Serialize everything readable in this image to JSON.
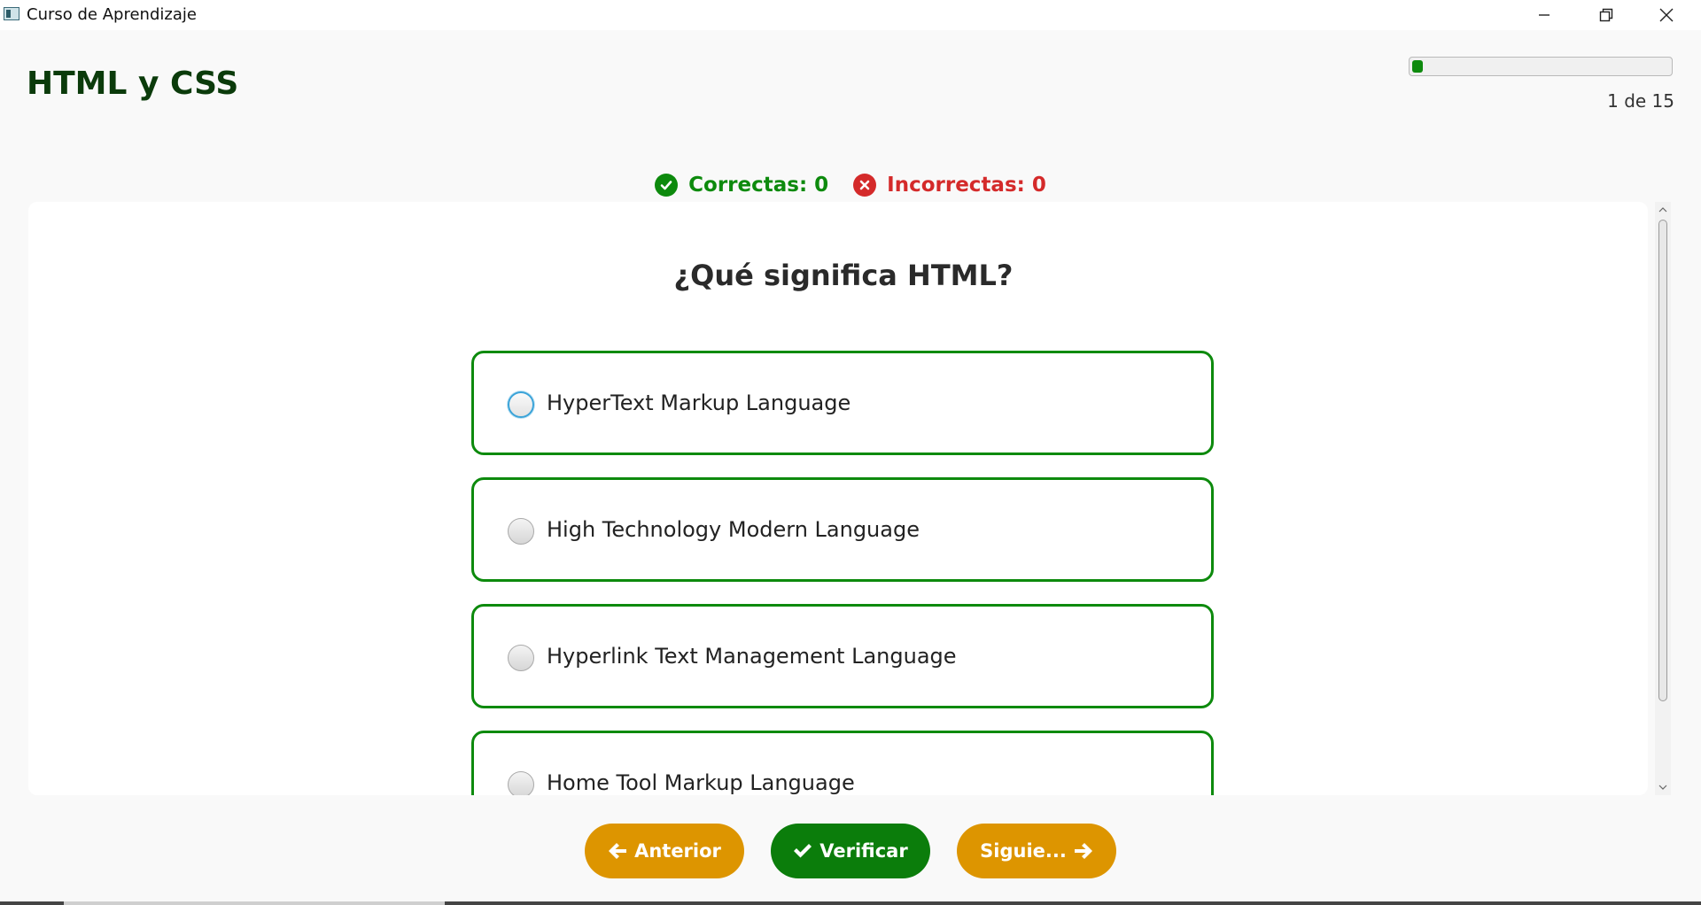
{
  "window": {
    "title": "Curso de Aprendizaje",
    "icons": {
      "minimize": "minimize-icon",
      "maximize": "restore-icon",
      "close": "close-icon"
    }
  },
  "header": {
    "course_title": "HTML y CSS",
    "progress": {
      "current": 1,
      "total": 15,
      "fraction": 0.0667,
      "text": "1 de 15"
    }
  },
  "scores": {
    "correct_label": "Correctas: 0",
    "incorrect_label": "Incorrectas: 0",
    "colors": {
      "correct": "#0d8a0d",
      "incorrect": "#d42a2a"
    }
  },
  "quiz": {
    "question": "¿Qué significa HTML?",
    "options": [
      {
        "label": "HyperText Markup Language",
        "selected": false,
        "focused": true
      },
      {
        "label": "High Technology Modern Language",
        "selected": false,
        "focused": false
      },
      {
        "label": "Hyperlink Text Management Language",
        "selected": false,
        "focused": false
      },
      {
        "label": "Home Tool Markup Language",
        "selected": false,
        "focused": false
      }
    ],
    "option_border_color": "#0d8a0d"
  },
  "buttons": {
    "previous_label": "Anterior",
    "verify_label": "Verificar",
    "next_label": "Siguie...",
    "colors": {
      "previous": "#dd9500",
      "verify": "#0b7d0b",
      "next": "#dd9500"
    }
  }
}
